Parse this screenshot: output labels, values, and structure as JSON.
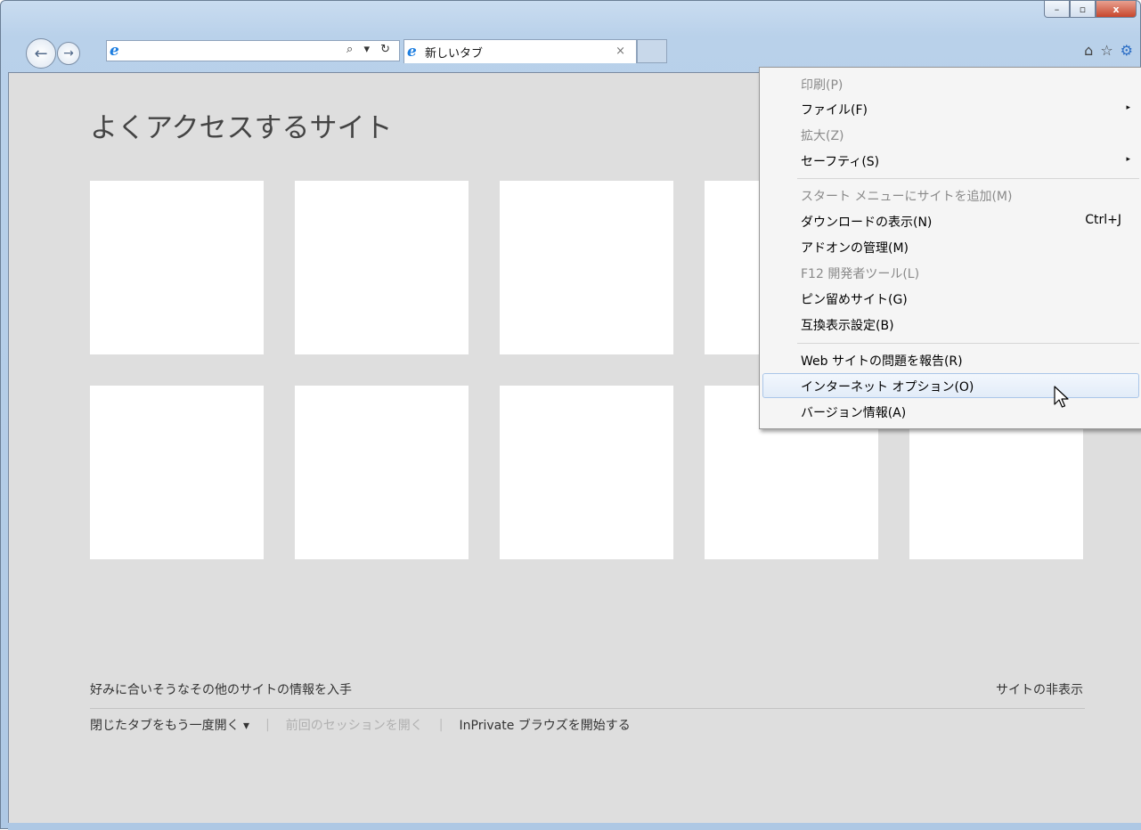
{
  "window": {
    "controls": {
      "minimize": "–",
      "maximize": "▫",
      "close": "x"
    }
  },
  "toolbar": {
    "back_icon": "←",
    "forward_icon": "→",
    "address_value": "",
    "address_tools": "⌕ ▾ ↻",
    "tab_label": "新しいタブ",
    "tab_close": "×",
    "home_icon": "⌂",
    "favorites_icon": "☆",
    "tools_icon": "⚙"
  },
  "newtab_page": {
    "heading": "よくアクセスするサイト",
    "tiles_count": 10,
    "suggest_link": "好みに合いそうなその他のサイトの情報を入手",
    "hide_sites_link": "サイトの非表示",
    "reopen_closed_tabs": "閉じたタブをもう一度開く ▾",
    "reopen_last_session": "前回のセッションを開く",
    "start_inprivate": "InPrivate ブラウズを開始する",
    "separator": "|"
  },
  "tools_menu": {
    "items": [
      {
        "label": "印刷(P)",
        "disabled": true
      },
      {
        "label": "ファイル(F)",
        "submenu": true
      },
      {
        "label": "拡大(Z)",
        "disabled": true
      },
      {
        "label": "セーフティ(S)",
        "submenu": true
      },
      {
        "label": "スタート メニューにサイトを追加(M)",
        "disabled": true
      },
      {
        "label": "ダウンロードの表示(N)",
        "shortcut": "Ctrl+J"
      },
      {
        "label": "アドオンの管理(M)"
      },
      {
        "label": "F12 開発者ツール(L)",
        "disabled": true
      },
      {
        "label": "ピン留めサイト(G)"
      },
      {
        "label": "互換表示設定(B)"
      },
      {
        "label": "Web サイトの問題を報告(R)"
      },
      {
        "label": "インターネット オプション(O)",
        "highlighted": true
      },
      {
        "label": "バージョン情報(A)"
      }
    ],
    "submenu_arrow": "▸"
  },
  "colors": {
    "content_bg": "#dedede",
    "tile": "#ffffff",
    "accent_ie": "#1d7ee0",
    "menu_bg": "#f5f5f5"
  }
}
